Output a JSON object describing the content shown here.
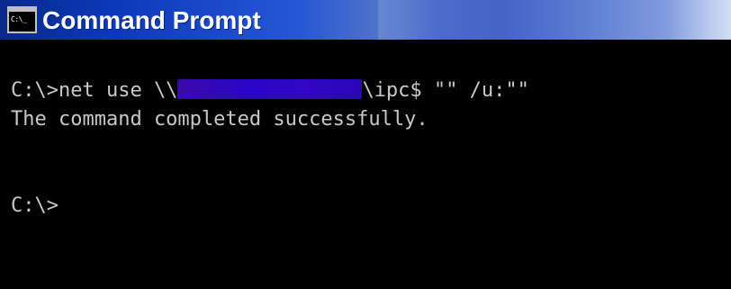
{
  "window": {
    "title": "Command Prompt",
    "icon": "command-prompt-icon",
    "icon_text": "C:\\_"
  },
  "console": {
    "line1_prefix": "C:\\>net use \\\\",
    "line1_suffix": "\\ipc$ \"\" /u:\"\"",
    "line2": "The command completed successfully.",
    "line3": "C:\\>"
  },
  "colors": {
    "titlebar_start": "#0a2a8a",
    "titlebar_end": "#d4def3",
    "console_bg": "#000000",
    "console_text": "#c8c8c8",
    "redaction": "#2a06c8"
  }
}
